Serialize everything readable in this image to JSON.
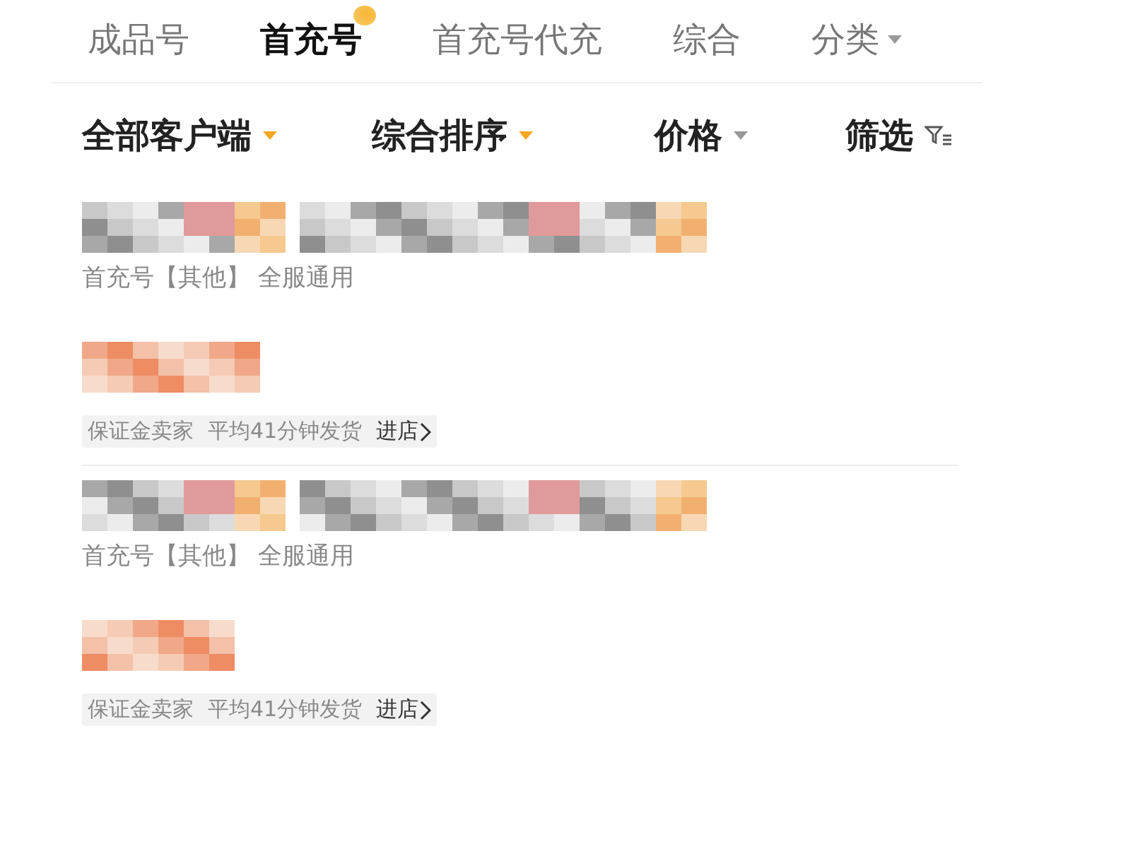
{
  "tabs": [
    {
      "label": "成品号",
      "selected": false,
      "dropdown": false
    },
    {
      "label": "首充号",
      "selected": true,
      "dropdown": false
    },
    {
      "label": "首充号代充",
      "selected": false,
      "dropdown": false
    },
    {
      "label": "综合",
      "selected": false,
      "dropdown": false
    },
    {
      "label": "分类",
      "selected": false,
      "dropdown": true
    }
  ],
  "filters": [
    {
      "label": "全部客户端",
      "kind": "dropdown",
      "active": true
    },
    {
      "label": "综合排序",
      "kind": "dropdown",
      "active": true
    },
    {
      "label": "价格",
      "kind": "dropdown",
      "active": false
    },
    {
      "label": "筛选",
      "kind": "filter"
    }
  ],
  "listings": [
    {
      "subtitle": "首充号【其他】 全服通用",
      "badges": [
        "保证金卖家",
        "平均41分钟发货"
      ],
      "shop_link": "进店"
    },
    {
      "subtitle": "首充号【其他】 全服通用",
      "badges": [
        "保证金卖家",
        "平均41分钟发货"
      ],
      "shop_link": "进店"
    }
  ]
}
